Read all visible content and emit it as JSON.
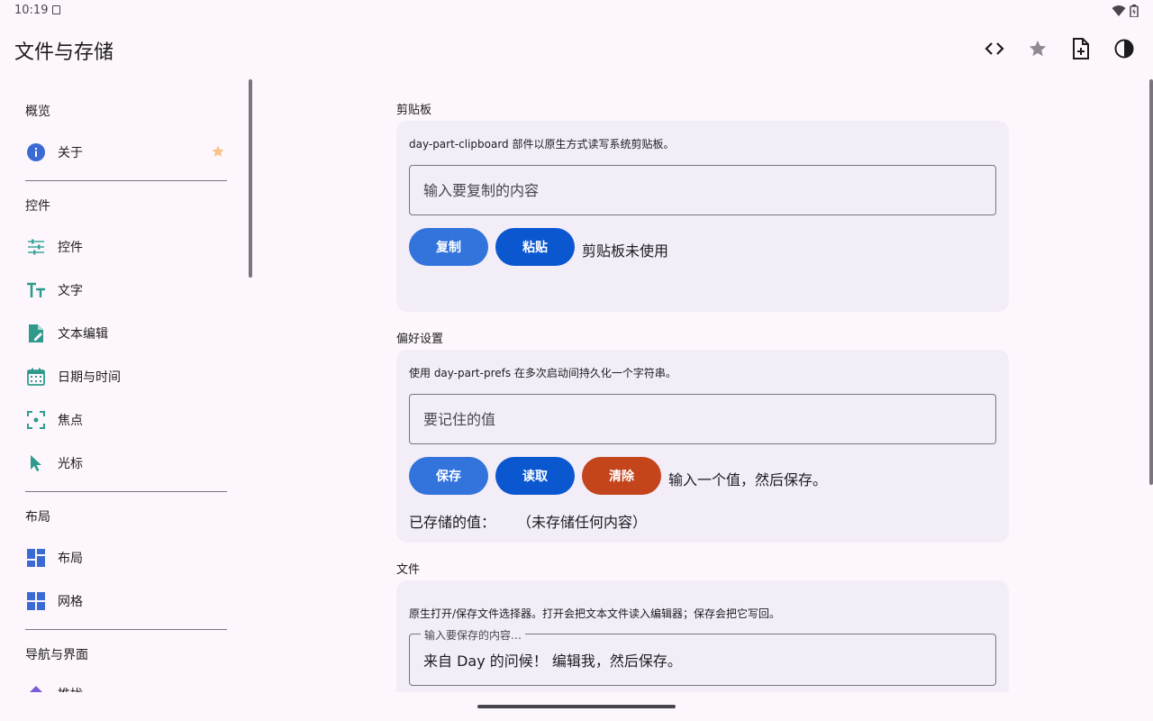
{
  "status_bar": {
    "time": "10:19"
  },
  "app": {
    "title": "文件与存储"
  },
  "toolbar": {
    "icons": [
      "code-icon",
      "star-icon",
      "file-add-icon",
      "contrast-icon"
    ]
  },
  "sidebar": {
    "sections": {
      "overview": "概览",
      "controls": "控件",
      "layout": "布局",
      "navigation": "导航与界面"
    },
    "items": {
      "about": "关于",
      "controls": "控件",
      "text": "文字",
      "text_edit": "文本编辑",
      "datetime": "日期与时间",
      "focus": "焦点",
      "cursor": "光标",
      "layout": "布局",
      "grid": "网格",
      "partial": "推拢"
    }
  },
  "clipboard": {
    "title": "剪贴板",
    "desc": "day-part-clipboard 部件以原生方式读写系统剪贴板。",
    "placeholder": "输入要复制的内容",
    "copy_label": "复制",
    "paste_label": "粘贴",
    "status": "剪贴板未使用"
  },
  "prefs": {
    "title": "偏好设置",
    "desc": "使用 day-part-prefs 在多次启动间持久化一个字符串。",
    "placeholder": "要记住的值",
    "save_label": "保存",
    "read_label": "读取",
    "clear_label": "清除",
    "status": "输入一个值，然后保存。",
    "stored_label": "已存储的值：",
    "stored_value": "（未存储任何内容）"
  },
  "files": {
    "title": "文件",
    "desc": "原生打开/保存文件选择器。打开会把文本文件读入编辑器；保存会把它写回。",
    "field_label": "输入要保存的内容…",
    "field_value": "来自 Day 的问候！ 编辑我，然后保存。"
  },
  "colors": {
    "background": "#fdf7fd",
    "card": "#f3edf7",
    "primary_button": "#3273dc",
    "dark_button": "#0b57d0",
    "danger_button": "#c4441c",
    "star": "#f5c48a"
  }
}
